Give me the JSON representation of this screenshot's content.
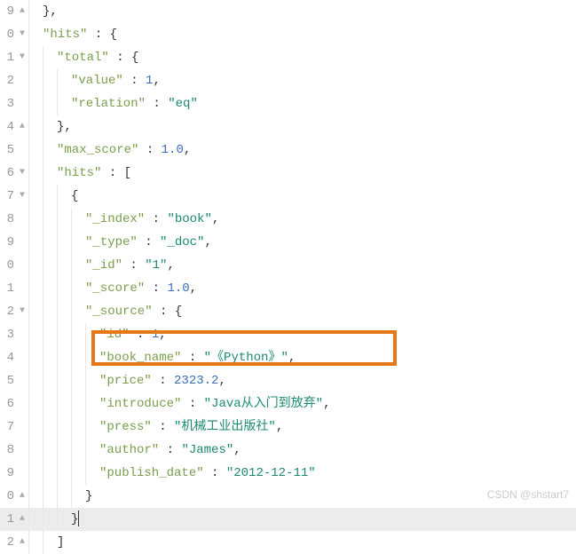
{
  "gutter": {
    "lines": [
      "9",
      "0",
      "1",
      "2",
      "3",
      "4",
      "5",
      "6",
      "7",
      "8",
      "9",
      "0",
      "1",
      "2",
      "3",
      "4",
      "5",
      "6",
      "7",
      "8",
      "9",
      "0",
      "1",
      "2"
    ],
    "fold_down": "▼",
    "fold_up": "▲"
  },
  "code": {
    "l0": "},",
    "l1_k": "\"hits\"",
    "l1_r": " : {",
    "l2_k": "\"total\"",
    "l2_r": " : {",
    "l3_k": "\"value\"",
    "l3_v": "1",
    "l4_k": "\"relation\"",
    "l4_v": "\"eq\"",
    "l5": "},",
    "l6_k": "\"max_score\"",
    "l6_v": "1.0",
    "l7_k": "\"hits\"",
    "l7_r": " : [",
    "l8": "{",
    "l9_k": "\"_index\"",
    "l9_v": "\"book\"",
    "l10_k": "\"_type\"",
    "l10_v": "\"_doc\"",
    "l11_k": "\"_id\"",
    "l11_v": "\"1\"",
    "l12_k": "\"_score\"",
    "l12_v": "1.0",
    "l13_k": "\"_source\"",
    "l13_r": " : {",
    "l14_k": "\"id\"",
    "l14_v": "1",
    "l15_k": "\"book_name\"",
    "l15_v": "\"《Python》\"",
    "l16_k": "\"price\"",
    "l16_v": "2323.2",
    "l17_k": "\"introduce\"",
    "l17_v": "\"Java从入门到放弃\"",
    "l18_k": "\"press\"",
    "l18_v": "\"机械工业出版社\"",
    "l19_k": "\"author\"",
    "l19_v": "\"James\"",
    "l20_k": "\"publish_date\"",
    "l20_v": "\"2012-12-11\"",
    "l21": "}",
    "l22": "}",
    "l23": "]"
  },
  "watermark": "CSDN @shstart7"
}
